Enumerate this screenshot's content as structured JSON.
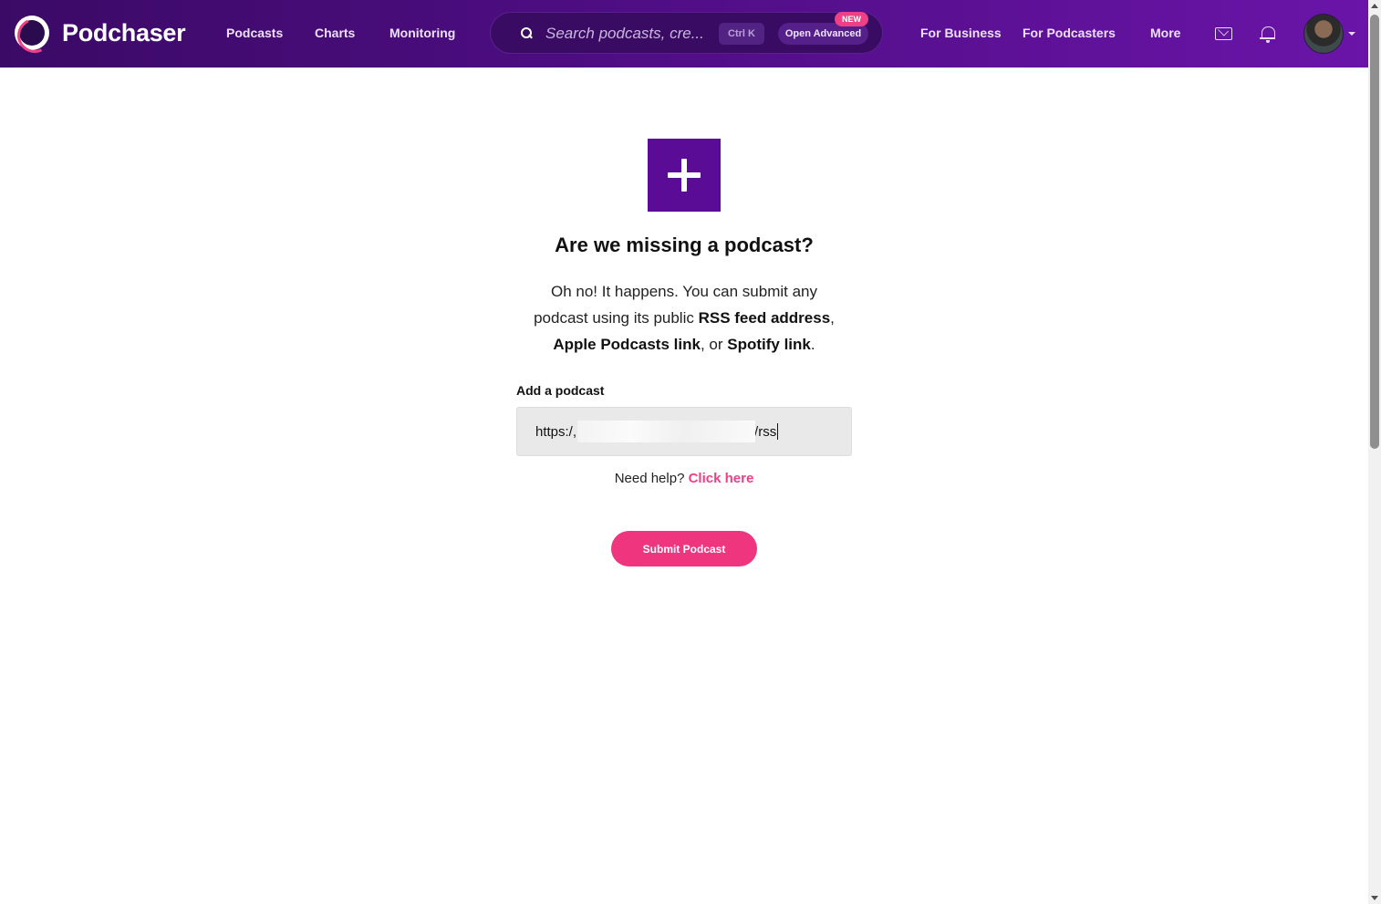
{
  "header": {
    "brand": "Podchaser",
    "nav": [
      "Podcasts",
      "Charts",
      "Monitoring"
    ],
    "search": {
      "placeholder": "Search podcasts, cre...",
      "shortcut": "Ctrl K",
      "advanced_label": "Open Advanced",
      "badge": "NEW"
    },
    "right_nav": [
      "For Business",
      "For Podcasters",
      "More"
    ],
    "icons": [
      "mail-icon",
      "bell-icon",
      "avatar"
    ]
  },
  "main": {
    "icon": "plus-icon",
    "title": "Are we missing a podcast?",
    "description": {
      "line1": "Oh no! It happens. You can submit any",
      "line2_pre": "podcast using its public ",
      "line2_bold": "RSS feed address",
      "line2_post": ",",
      "line3_bold1": "Apple Podcasts link",
      "line3_mid": ", or ",
      "line3_bold2": "Spotify link",
      "line3_post": "."
    },
    "field_label": "Add a podcast",
    "field_value_start": "https:/,",
    "field_value_end": "/rss",
    "help_text": "Need help? ",
    "help_link": "Click here",
    "submit_label": "Submit Podcast"
  },
  "colors": {
    "header_start": "#3b0a66",
    "header_end": "#6a14a8",
    "accent_pink": "#ef3f87",
    "tile_purple": "#5b0c96"
  }
}
